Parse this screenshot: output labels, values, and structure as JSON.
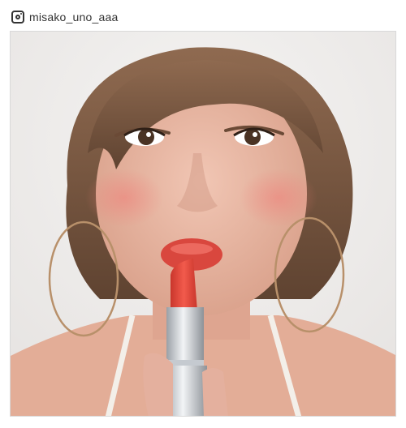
{
  "header": {
    "icon": "instagram-icon",
    "username": "misako_uno_aaa"
  },
  "photo": {
    "subject": "portrait-photo",
    "colors": {
      "background": "#eeeceb",
      "hair": "#7a5a43",
      "skin": "#e7b7a3",
      "lipstick": "#e9483b",
      "tube": "#d0d4d8"
    }
  }
}
